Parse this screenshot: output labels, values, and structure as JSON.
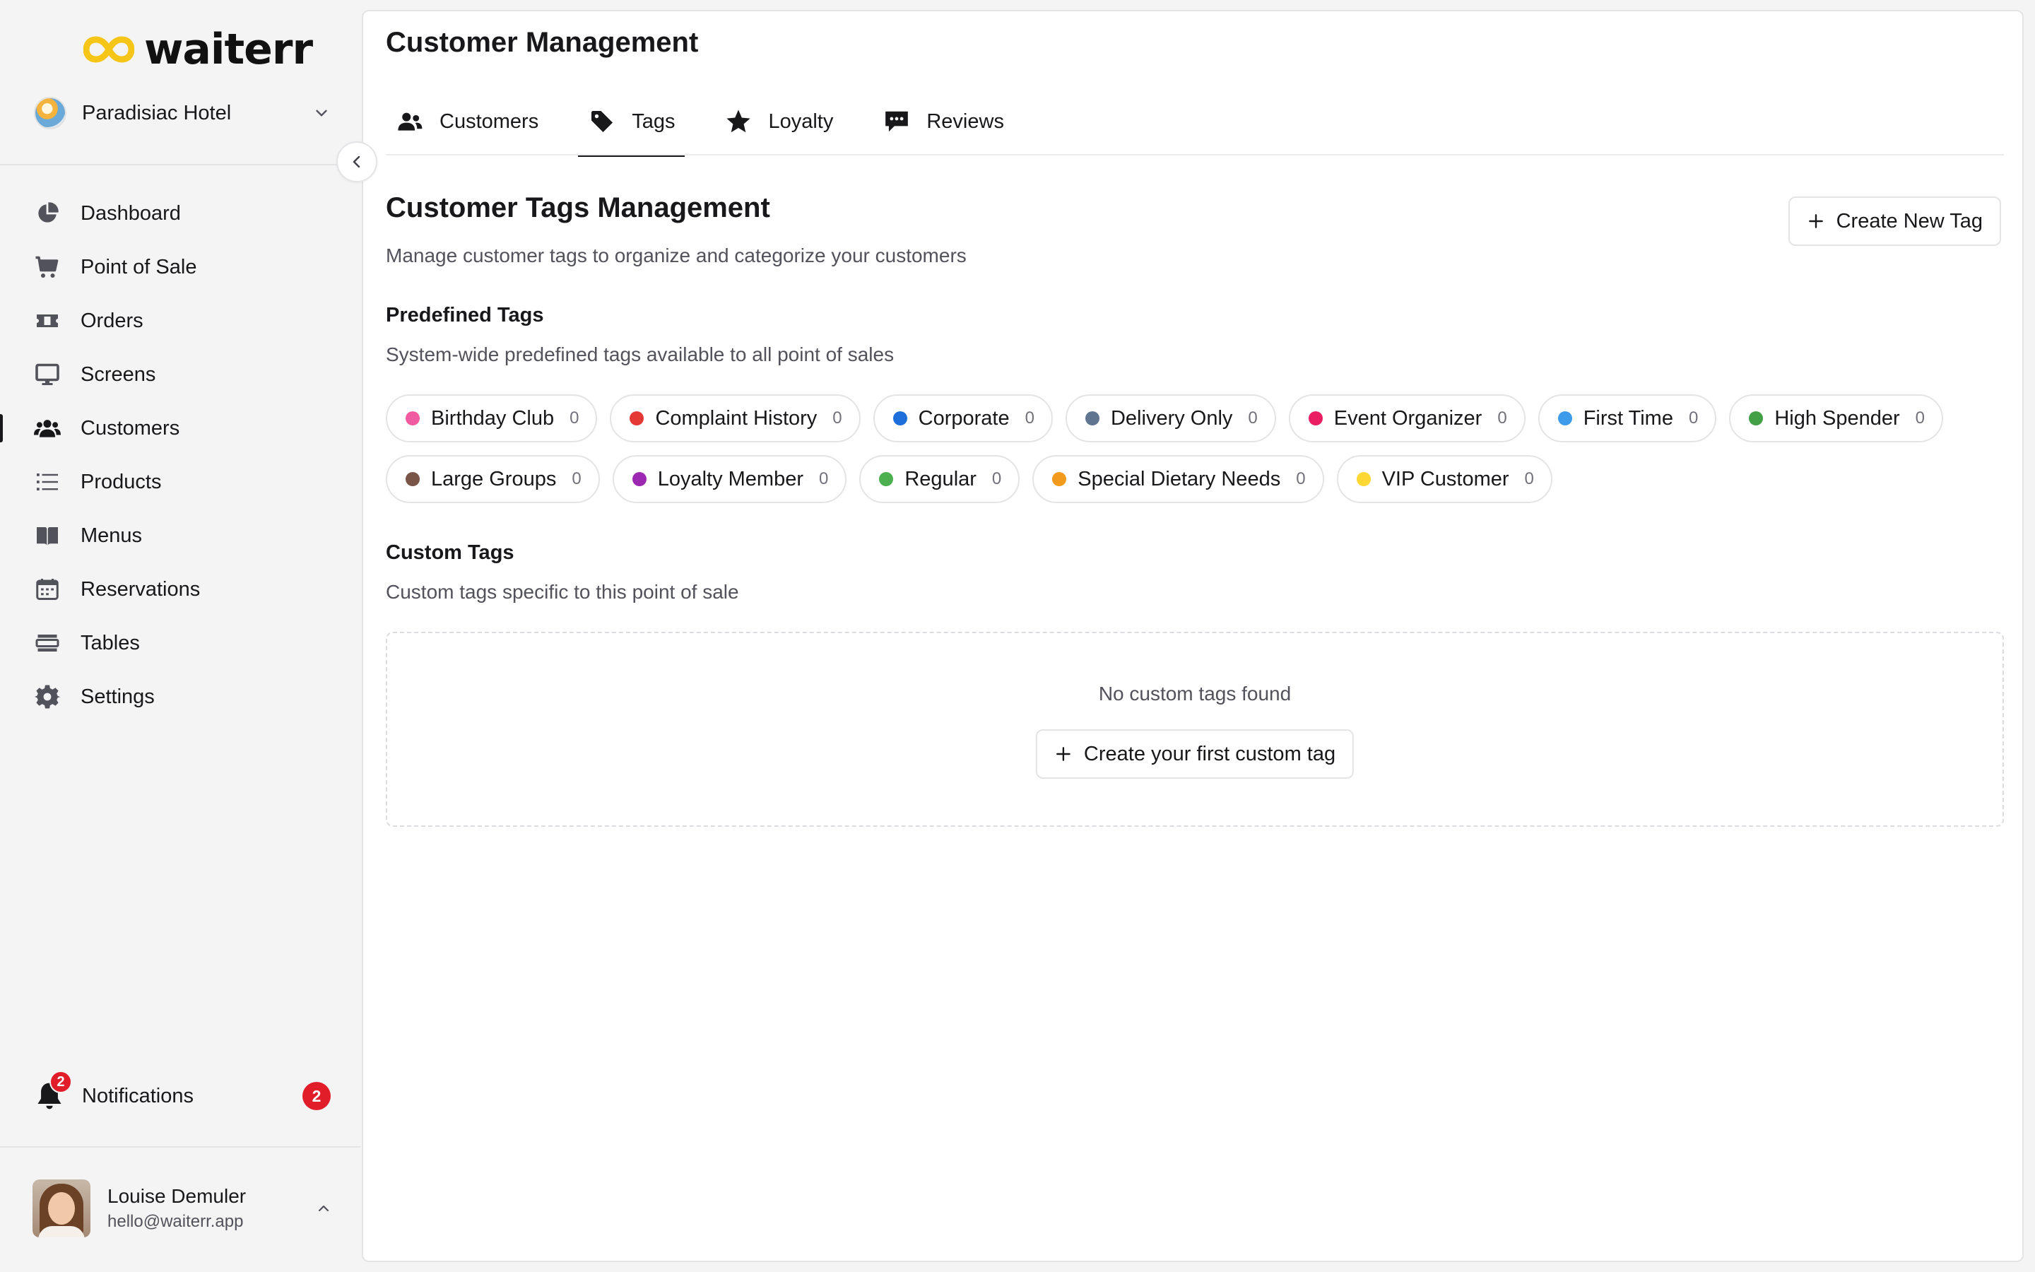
{
  "brand": {
    "name": "waiterr",
    "accent": "#f5c518"
  },
  "venue": {
    "name": "Paradisiac Hotel"
  },
  "sidebar": {
    "items": [
      {
        "label": "Dashboard",
        "icon": "pie-chart-icon"
      },
      {
        "label": "Point of Sale",
        "icon": "cart-icon"
      },
      {
        "label": "Orders",
        "icon": "ticket-icon"
      },
      {
        "label": "Screens",
        "icon": "monitor-icon"
      },
      {
        "label": "Customers",
        "icon": "users-icon",
        "active": true
      },
      {
        "label": "Products",
        "icon": "list-icon"
      },
      {
        "label": "Menus",
        "icon": "book-icon"
      },
      {
        "label": "Reservations",
        "icon": "calendar-icon"
      },
      {
        "label": "Tables",
        "icon": "table-icon"
      },
      {
        "label": "Settings",
        "icon": "gear-icon"
      }
    ],
    "notifications": {
      "label": "Notifications",
      "count": "2",
      "badge": "2"
    },
    "user": {
      "name": "Louise Demuler",
      "email": "hello@waiterr.app"
    }
  },
  "header": {
    "title": "Customer Management",
    "tabs": [
      {
        "label": "Customers",
        "icon": "users-icon"
      },
      {
        "label": "Tags",
        "icon": "tag-icon",
        "active": true
      },
      {
        "label": "Loyalty",
        "icon": "star-icon"
      },
      {
        "label": "Reviews",
        "icon": "chat-icon"
      }
    ]
  },
  "main": {
    "title": "Customer Tags Management",
    "description": "Manage customer tags to organize and categorize your customers",
    "create_button": "Create New Tag",
    "predefined": {
      "title": "Predefined Tags",
      "description": "System-wide predefined tags available to all point of sales",
      "tags": [
        {
          "name": "Birthday Club",
          "count": "0",
          "color": "#f05aa0"
        },
        {
          "name": "Complaint History",
          "count": "0",
          "color": "#e53935"
        },
        {
          "name": "Corporate",
          "count": "0",
          "color": "#1e6fd9"
        },
        {
          "name": "Delivery Only",
          "count": "0",
          "color": "#5f7590"
        },
        {
          "name": "Event Organizer",
          "count": "0",
          "color": "#e91e63"
        },
        {
          "name": "First Time",
          "count": "0",
          "color": "#3d9be9"
        },
        {
          "name": "High Spender",
          "count": "0",
          "color": "#43a047"
        },
        {
          "name": "Large Groups",
          "count": "0",
          "color": "#795548"
        },
        {
          "name": "Loyalty Member",
          "count": "0",
          "color": "#9c27b0"
        },
        {
          "name": "Regular",
          "count": "0",
          "color": "#4caf50"
        },
        {
          "name": "Special Dietary Needs",
          "count": "0",
          "color": "#f29a1c"
        },
        {
          "name": "VIP Customer",
          "count": "0",
          "color": "#fdd835"
        }
      ]
    },
    "custom": {
      "title": "Custom Tags",
      "description": "Custom tags specific to this point of sale",
      "empty_text": "No custom tags found",
      "empty_button": "Create your first custom tag"
    }
  }
}
